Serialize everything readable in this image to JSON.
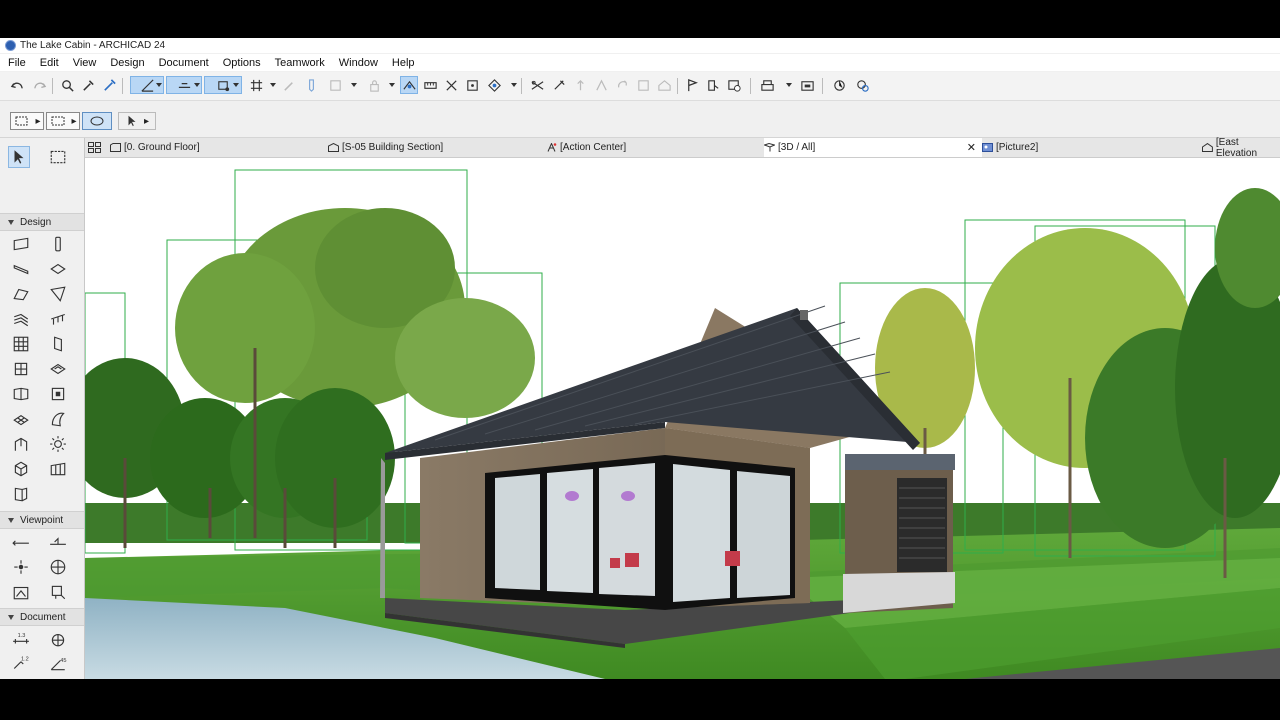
{
  "window": {
    "title": "The Lake Cabin - ARCHICAD 24"
  },
  "menu": [
    "File",
    "Edit",
    "View",
    "Design",
    "Document",
    "Options",
    "Teamwork",
    "Window",
    "Help"
  ],
  "tabs": [
    {
      "label": "[0. Ground Floor]",
      "icon": "floor-plan-icon"
    },
    {
      "label": "[S-05 Building Section]",
      "icon": "section-icon"
    },
    {
      "label": "[Action Center]",
      "icon": "action-center-icon"
    },
    {
      "label": "[3D / All]",
      "icon": "3d-view-icon",
      "active": true
    },
    {
      "label": "[Picture2]",
      "icon": "picture-icon"
    },
    {
      "label": "[East Elevation",
      "icon": "elevation-icon"
    }
  ],
  "toolbox": {
    "sections": [
      {
        "label": "Design"
      },
      {
        "label": "Viewpoint"
      },
      {
        "label": "Document"
      }
    ]
  },
  "colors": {
    "accent": "#b9d7f5",
    "sky": "#ffffff",
    "grass": "#4a9a2c",
    "roof": "#3a3f48",
    "wood": "#7a6a55"
  }
}
